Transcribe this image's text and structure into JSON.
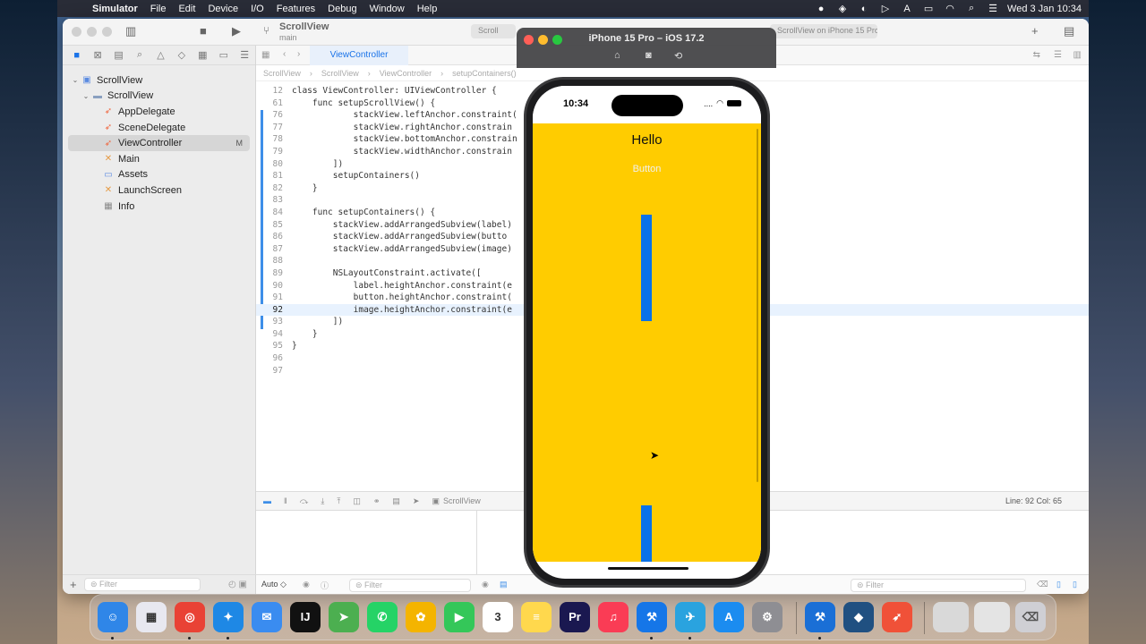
{
  "menubar": {
    "app_name": "Simulator",
    "menus": [
      "File",
      "Edit",
      "Device",
      "I/O",
      "Features",
      "Debug",
      "Window",
      "Help"
    ],
    "clock": "Wed 3 Jan  10:34",
    "input_indicator": "A"
  },
  "xcode": {
    "scheme": {
      "name": "ScrollView",
      "branch": "main"
    },
    "tabs": [
      "Scroll",
      "ScrollView on iPhone 15 Pro"
    ],
    "navigator": {
      "items": [
        {
          "label": "ScrollView",
          "icon": "project-icon",
          "level": 0
        },
        {
          "label": "ScrollView",
          "icon": "folder-icon",
          "level": 1
        },
        {
          "label": "AppDelegate",
          "icon": "swift-file-icon",
          "level": 2
        },
        {
          "label": "SceneDelegate",
          "icon": "swift-file-icon",
          "level": 2
        },
        {
          "label": "ViewController",
          "icon": "swift-file-icon",
          "level": 2,
          "badge": "M",
          "selected": true
        },
        {
          "label": "Main",
          "icon": "storyboard-icon",
          "level": 2
        },
        {
          "label": "Assets",
          "icon": "assets-icon",
          "level": 2
        },
        {
          "label": "LaunchScreen",
          "icon": "storyboard-icon",
          "level": 2
        },
        {
          "label": "Info",
          "icon": "plist-icon",
          "level": 2
        }
      ],
      "filter_placeholder": "Filter"
    },
    "editor": {
      "active_tab": "ViewController",
      "breadcrumb": [
        "ScrollView",
        "ScrollView",
        "ViewController",
        "setupContainers()"
      ],
      "sticky_lines": [
        {
          "n": "12",
          "text": "class ViewController: UIViewController {"
        },
        {
          "n": "61",
          "text": "    func setupScrollView() {"
        }
      ],
      "lines": [
        {
          "n": "76",
          "text": "            stackView.leftAnchor.constraint("
        },
        {
          "n": "77",
          "text": "            stackView.rightAnchor.constrain"
        },
        {
          "n": "78",
          "text": "            stackView.bottomAnchor.constrain"
        },
        {
          "n": "79",
          "text": "            stackView.widthAnchor.constrain"
        },
        {
          "n": "80",
          "text": "        ])"
        },
        {
          "n": "81",
          "text": "        setupContainers()"
        },
        {
          "n": "82",
          "text": "    }"
        },
        {
          "n": "83",
          "text": ""
        },
        {
          "n": "84",
          "text": "    func setupContainers() {"
        },
        {
          "n": "85",
          "text": "        stackView.addArrangedSubview(label)"
        },
        {
          "n": "86",
          "text": "        stackView.addArrangedSubview(butto"
        },
        {
          "n": "87",
          "text": "        stackView.addArrangedSubview(image)"
        },
        {
          "n": "88",
          "text": ""
        },
        {
          "n": "89",
          "text": "        NSLayoutConstraint.activate(["
        },
        {
          "n": "90",
          "text": "            label.heightAnchor.constraint(e"
        },
        {
          "n": "91",
          "text": "            button.heightAnchor.constraint("
        },
        {
          "n": "92",
          "text": "            image.heightAnchor.constraint(e"
        },
        {
          "n": "93",
          "text": "        ])"
        },
        {
          "n": "94",
          "text": "    }"
        },
        {
          "n": "95",
          "text": "}"
        },
        {
          "n": "96",
          "text": ""
        },
        {
          "n": "97",
          "text": ""
        }
      ],
      "current_line": "92"
    },
    "debug": {
      "target": "ScrollView",
      "line_col": "Line: 92  Col: 65",
      "auto_label": "Auto ◇",
      "filter_placeholder": "Filter"
    }
  },
  "simulator": {
    "title": "iPhone 15 Pro – iOS 17.2",
    "status_time": "10:34",
    "status_signal": "....",
    "app": {
      "label_text": "Hello",
      "button_title": "Button",
      "background_color": "#FFCC00",
      "image_color": "#0A72E8"
    }
  },
  "dock": {
    "apps": [
      {
        "name": "finder-icon",
        "text": "☺",
        "color": "#2f86e8"
      },
      {
        "name": "launchpad-icon",
        "text": "▦",
        "color": "#e8e8f0"
      },
      {
        "name": "chrome-icon",
        "text": "◎",
        "color": "#e94235"
      },
      {
        "name": "safari-icon",
        "text": "✦",
        "color": "#1e88e5"
      },
      {
        "name": "mail-icon",
        "text": "✉",
        "color": "#3a8cf0"
      },
      {
        "name": "intellij-icon",
        "text": "IJ",
        "color": "#111111"
      },
      {
        "name": "maps-icon",
        "text": "➤",
        "color": "#4caf50"
      },
      {
        "name": "whatsapp-icon",
        "text": "✆",
        "color": "#25d366"
      },
      {
        "name": "photos-icon",
        "text": "✿",
        "color": "#f4b400"
      },
      {
        "name": "facetime-icon",
        "text": "▶",
        "color": "#34c759"
      },
      {
        "name": "calendar-icon",
        "text": "3",
        "color": "#ffffff"
      },
      {
        "name": "notes-icon",
        "text": "≡",
        "color": "#ffd84d"
      },
      {
        "name": "premiere-icon",
        "text": "Pr",
        "color": "#1a1850"
      },
      {
        "name": "music-icon",
        "text": "♫",
        "color": "#fa3c55"
      },
      {
        "name": "xcode-icon",
        "text": "⚒",
        "color": "#1576e8"
      },
      {
        "name": "telegram-icon",
        "text": "✈",
        "color": "#2aa3df"
      },
      {
        "name": "app-store-icon",
        "text": "A",
        "color": "#1b8cf0"
      },
      {
        "name": "system-settings-icon",
        "text": "⚙",
        "color": "#8e8e93"
      },
      {
        "name": "xcode-alt-icon",
        "text": "⚒",
        "color": "#1a6fd6"
      },
      {
        "name": "sourcetree-icon",
        "text": "◆",
        "color": "#205081"
      },
      {
        "name": "swift-icon",
        "text": "➶",
        "color": "#f05138"
      }
    ],
    "calendar_month": "JAN"
  }
}
